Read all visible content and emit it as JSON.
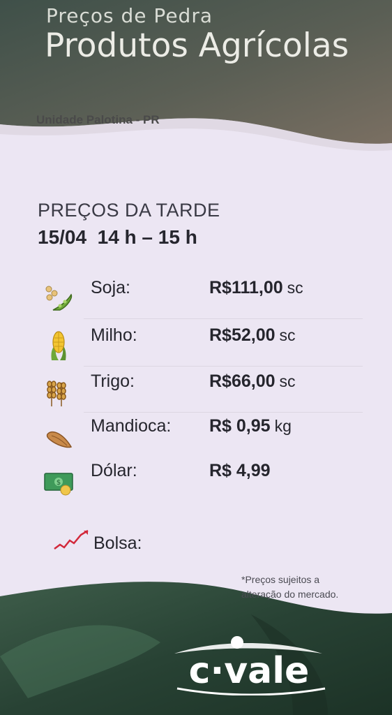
{
  "header": {
    "supertitle": "Preços de Pedra",
    "title": "Produtos Agrícolas",
    "unit": "Unidade Palotina - PR"
  },
  "period": {
    "title": "PREÇOS DA  TARDE",
    "time": "15/04  14 h – 15 h"
  },
  "prices": [
    {
      "label": "Soja:",
      "value": "R$111,00",
      "unit": "sc",
      "icon": "soybean-icon"
    },
    {
      "label": "Milho:",
      "value": "R$52,00",
      "unit": "sc",
      "icon": "corn-icon"
    },
    {
      "label": "Trigo:",
      "value": "R$66,00",
      "unit": "sc",
      "icon": "wheat-icon"
    },
    {
      "label": "Mandioca:",
      "value": "R$ 0,95",
      "unit": "kg",
      "icon": "cassava-icon"
    },
    {
      "label": "Dólar:",
      "value": "R$ 4,99",
      "unit": "",
      "icon": "money-icon"
    },
    {
      "label": "Bolsa:",
      "value": "",
      "unit": "",
      "icon": "chart-trend-icon"
    }
  ],
  "footnote": {
    "line1": "*Preços sujeitos a",
    "line2": "alteração do mercado."
  },
  "logo": {
    "text": "c·vale"
  },
  "colors": {
    "header_dark": "#4d5a52",
    "background": "#ece6f3",
    "text": "#25252d",
    "footer_green": "#2f4a3c"
  }
}
